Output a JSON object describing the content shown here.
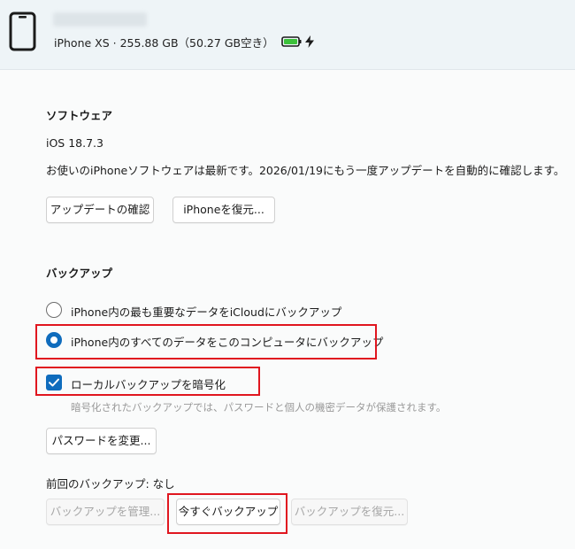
{
  "header": {
    "device_info": "iPhone XS · 255.88 GB（50.27 GB空き）",
    "icons": [
      "phone-icon",
      "battery-icon",
      "charging-bolt-icon"
    ]
  },
  "software": {
    "title": "ソフトウェア",
    "ios_version": "iOS 18.7.3",
    "status_text": "お使いのiPhoneソフトウェアは最新です。2026/01/19にもう一度アップデートを自動的に確認します。",
    "check_update_label": "アップデートの確認",
    "restore_iphone_label": "iPhoneを復元..."
  },
  "backup": {
    "title": "バックアップ",
    "options": [
      {
        "label": "iPhone内の最も重要なデータをiCloudにバックアップ",
        "selected": false
      },
      {
        "label": "iPhone内のすべてのデータをこのコンピュータにバックアップ",
        "selected": true
      }
    ],
    "encrypt_label": "ローカルバックアップを暗号化",
    "encrypt_checked": true,
    "encrypt_hint": "暗号化されたバックアップでは、パスワードと個人の機密データが保護されます。",
    "change_password_label": "パスワードを変更...",
    "last_backup": "前回のバックアップ: なし",
    "manage_backups_label": "バックアップを管理...",
    "backup_now_label": "今すぐバックアップ",
    "restore_backup_label": "バックアップを復元..."
  },
  "colors": {
    "accent": "#0f6cbd",
    "highlight_border": "#e0161f",
    "battery_green": "#3cc13b",
    "header_bg": "#eef4f7"
  }
}
